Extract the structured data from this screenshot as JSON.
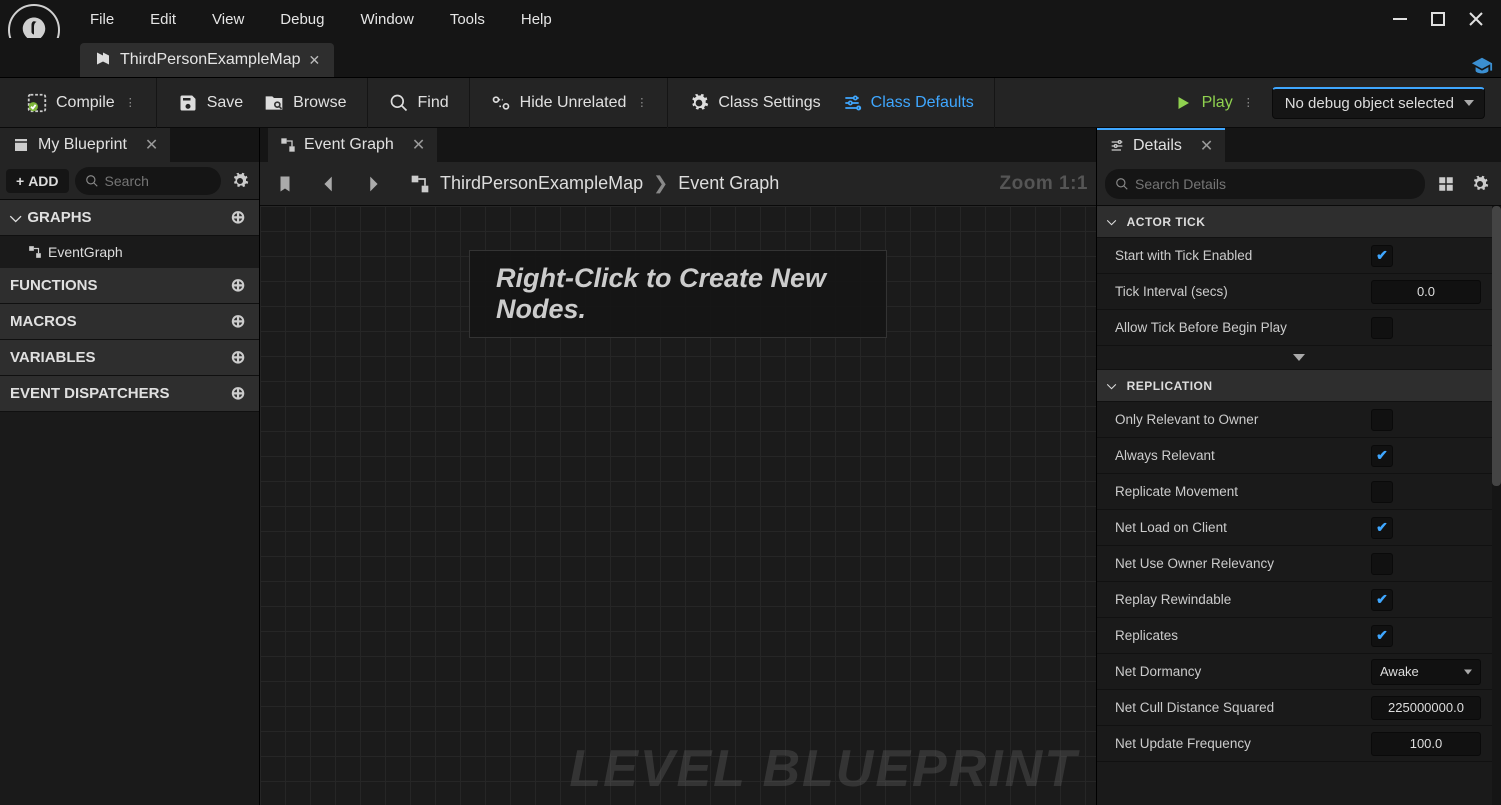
{
  "menubar": {
    "items": [
      "File",
      "Edit",
      "View",
      "Debug",
      "Window",
      "Tools",
      "Help"
    ]
  },
  "document_tab": {
    "title": "ThirdPersonExampleMap"
  },
  "toolbar": {
    "compile": "Compile",
    "save": "Save",
    "browse": "Browse",
    "find": "Find",
    "hide_unrelated": "Hide Unrelated",
    "class_settings": "Class Settings",
    "class_defaults": "Class Defaults",
    "play": "Play",
    "debug_object": "No debug object selected"
  },
  "left": {
    "tab_title": "My Blueprint",
    "add": "ADD",
    "search_placeholder": "Search",
    "sections": {
      "graphs": "GRAPHS",
      "graphs_item": "EventGraph",
      "functions": "FUNCTIONS",
      "macros": "MACROS",
      "variables": "VARIABLES",
      "dispatchers": "EVENT DISPATCHERS"
    }
  },
  "center": {
    "tab_title": "Event Graph",
    "breadcrumb_root": "ThirdPersonExampleMap",
    "breadcrumb_leaf": "Event Graph",
    "zoom": "Zoom 1:1",
    "hint": "Right-Click to Create New Nodes.",
    "watermark": "LEVEL BLUEPRINT"
  },
  "right": {
    "tab_title": "Details",
    "search_placeholder": "Search Details",
    "categories": {
      "actor_tick": "ACTOR TICK",
      "replication": "REPLICATION"
    },
    "props": {
      "start_tick": {
        "label": "Start with Tick Enabled",
        "checked": true
      },
      "tick_interval": {
        "label": "Tick Interval (secs)",
        "value": "0.0"
      },
      "allow_before_begin": {
        "label": "Allow Tick Before Begin Play",
        "checked": false
      },
      "only_relevant_owner": {
        "label": "Only Relevant to Owner",
        "checked": false
      },
      "always_relevant": {
        "label": "Always Relevant",
        "checked": true
      },
      "replicate_movement": {
        "label": "Replicate Movement",
        "checked": false
      },
      "net_load_client": {
        "label": "Net Load on Client",
        "checked": true
      },
      "net_use_owner": {
        "label": "Net Use Owner Relevancy",
        "checked": false
      },
      "replay_rewindable": {
        "label": "Replay Rewindable",
        "checked": true
      },
      "replicates": {
        "label": "Replicates",
        "checked": true
      },
      "net_dormancy": {
        "label": "Net Dormancy",
        "value": "Awake"
      },
      "net_cull_dist": {
        "label": "Net Cull Distance Squared",
        "value": "225000000.0"
      },
      "net_update_freq": {
        "label": "Net Update Frequency",
        "value": "100.0"
      }
    }
  }
}
